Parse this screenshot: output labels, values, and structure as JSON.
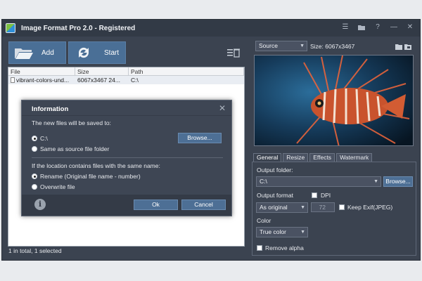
{
  "window": {
    "title": "Image Format Pro 2.0 - Registered"
  },
  "toolbar": {
    "add_label": "Add",
    "start_label": "Start"
  },
  "file_list": {
    "columns": [
      "File",
      "Size",
      "Path"
    ],
    "rows": [
      {
        "file": "vibrant-colors-und...",
        "size": "6067x3467   24...",
        "path": "C:\\"
      }
    ]
  },
  "status": {
    "text": "1 in total, 1 selected"
  },
  "dialog": {
    "title": "Information",
    "saved_to_text": "The new files will be saved to:",
    "option_path": "C:\\",
    "option_same": "Same as source file folder",
    "browse_label": "Browse...",
    "same_name_text": "If the location contains files with the same name:",
    "option_rename": "Rename (Original file name - number)",
    "option_overwrite": "Overwrite file",
    "ok_label": "Ok",
    "cancel_label": "Cancel"
  },
  "preview": {
    "source_select": "Source",
    "size_text": "Size: 6067x3467"
  },
  "tabs": [
    "General",
    "Resize",
    "Effects",
    "Watermark"
  ],
  "settings": {
    "output_folder_label": "Output folder:",
    "output_folder_value": "C:\\",
    "browse_label": "Browse...",
    "output_format_label": "Output format",
    "dpi_label": "DPI",
    "format_value": "As original",
    "dpi_value": "72",
    "keep_exif_label": "Keep Exif(JPEG)",
    "color_label": "Color",
    "color_value": "True color",
    "remove_alpha_label": "Remove alpha"
  },
  "colors": {
    "accent": "#4a6f96",
    "window_bg": "#3b4350",
    "titlebar": "#323a46"
  },
  "icons": [
    "folder-open-icon",
    "refresh-icon",
    "list-delete-icon",
    "menu-icon",
    "folder-icon",
    "help-icon",
    "minimize-icon",
    "close-icon",
    "info-icon"
  ]
}
